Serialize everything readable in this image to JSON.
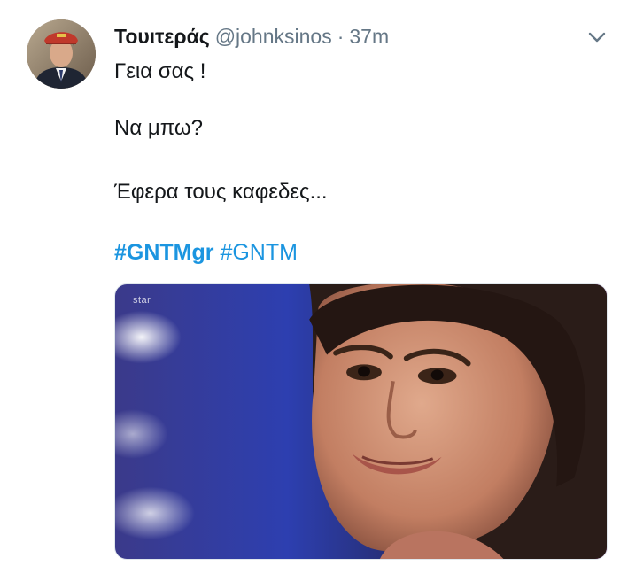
{
  "tweet": {
    "display_name": "Τουιτεράς",
    "handle": "@johnksinos",
    "separator": "·",
    "timestamp": "37m",
    "lines": [
      "Γεια σας !",
      "Να μπω?",
      "Έφερα τους καφεδες..."
    ],
    "hashtags": [
      {
        "text": "#GNTMgr",
        "bold": true
      },
      {
        "text": "#GNTM",
        "bold": false
      }
    ],
    "media": {
      "watermark": "star"
    }
  },
  "colors": {
    "link": "#1b95e0",
    "secondary_text": "#657786",
    "primary_text": "#14171a",
    "border": "#e1e8ed"
  },
  "icons": {
    "caret": "chevron-down-icon",
    "avatar": "profile-photo"
  }
}
